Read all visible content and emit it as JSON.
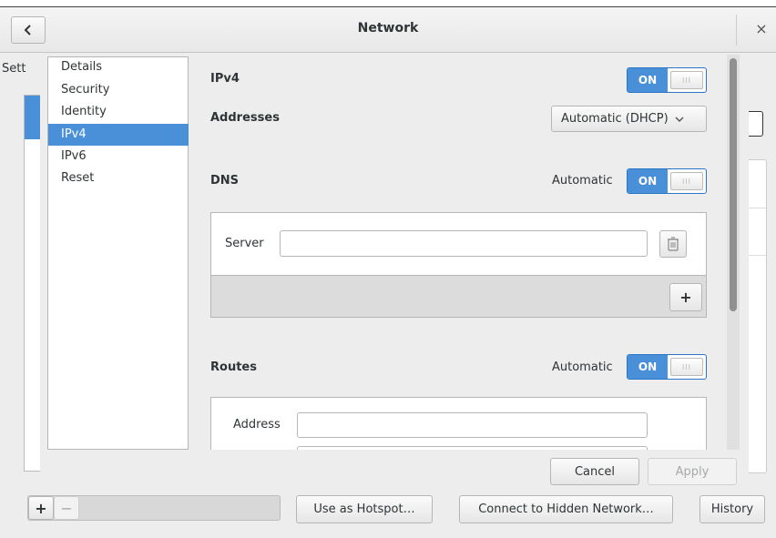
{
  "window": {
    "title": "Network",
    "back_icon": "back-arrow-icon",
    "close_label": "×"
  },
  "background": {
    "settings_label": "Sett",
    "use_hotspot": "Use as Hotspot…",
    "connect_hidden": "Connect to Hidden Network…",
    "history": "History",
    "add_label": "+",
    "remove_label": "−"
  },
  "sidebar": {
    "items": [
      "Details",
      "Security",
      "Identity",
      "IPv4",
      "IPv6",
      "Reset"
    ],
    "selected": "IPv4"
  },
  "ipv4": {
    "title": "IPv4",
    "toggle_on": "ON",
    "addresses_label": "Addresses",
    "addresses_value": "Automatic (DHCP)",
    "dns_label": "DNS",
    "dns_auto_label": "Automatic",
    "dns_toggle": "ON",
    "server_label": "Server",
    "server_value": "",
    "add_server": "+",
    "routes_label": "Routes",
    "routes_auto_label": "Automatic",
    "routes_toggle": "ON",
    "route_address_label": "Address",
    "route_address_value": ""
  },
  "footer": {
    "cancel": "Cancel",
    "apply": "Apply"
  },
  "colors": {
    "accent": "#4a90d9",
    "window_bg": "#ededed"
  }
}
